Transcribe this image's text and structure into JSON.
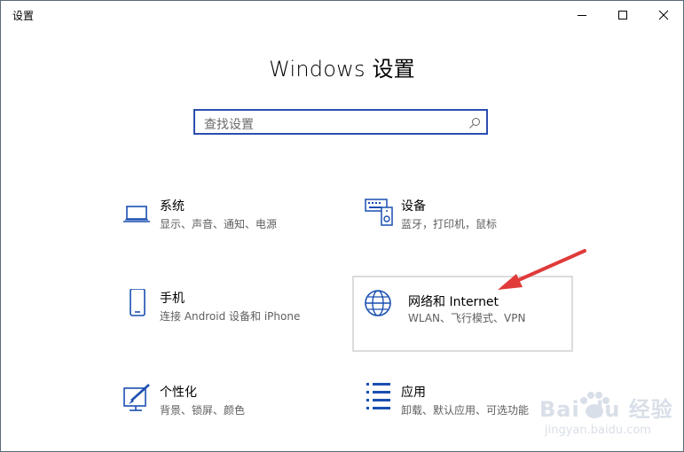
{
  "window": {
    "title": "设置",
    "minimize_icon": "minimize-icon",
    "maximize_icon": "maximize-icon",
    "close_icon": "close-icon"
  },
  "main": {
    "heading": "Windows 设置",
    "search": {
      "placeholder": "查找设置",
      "icon": "search-icon"
    }
  },
  "tiles": [
    {
      "icon": "laptop-icon",
      "title": "系统",
      "subtitle": "显示、声音、通知、电源"
    },
    {
      "icon": "devices-icon",
      "title": "设备",
      "subtitle": "蓝牙，打印机，鼠标"
    },
    {
      "icon": "phone-icon",
      "title": "手机",
      "subtitle": "连接 Android 设备和 iPhone"
    },
    {
      "icon": "globe-icon",
      "title": "网络和 Internet",
      "subtitle": "WLAN、飞行模式、VPN"
    },
    {
      "icon": "personalization-icon",
      "title": "个性化",
      "subtitle": "背景、锁屏、颜色"
    },
    {
      "icon": "apps-icon",
      "title": "应用",
      "subtitle": "卸载、默认应用、可选功能"
    }
  ],
  "colors": {
    "accent": "#2c4db0",
    "icon_blue": "#1a4fb0",
    "arrow": "#e03a3a",
    "hover_border": "#dcdcdc"
  },
  "watermark": {
    "logo": "Bai du 经验",
    "url": "jingyan.baidu.com"
  }
}
